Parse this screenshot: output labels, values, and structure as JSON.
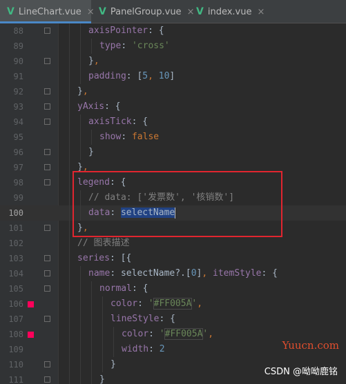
{
  "tabs": [
    {
      "label": "LineChart.vue",
      "icon": "vue-icon",
      "active": true
    },
    {
      "label": "PanelGroup.vue",
      "icon": "vue-icon",
      "active": false
    },
    {
      "label": "index.vue",
      "icon": "vue-icon",
      "active": false
    }
  ],
  "close_glyph": "×",
  "lines": [
    {
      "num": "88",
      "indent": 2,
      "tokens": [
        [
          "k",
          "axisPointer"
        ],
        [
          "plain",
          ": {"
        ]
      ],
      "fold": true
    },
    {
      "num": "89",
      "indent": 3,
      "tokens": [
        [
          "k",
          "type"
        ],
        [
          "plain",
          ": "
        ],
        [
          "s",
          "'cross'"
        ]
      ]
    },
    {
      "num": "90",
      "indent": 2,
      "tokens": [
        [
          "plain",
          "}"
        ],
        [
          "p",
          ","
        ]
      ],
      "fold": true
    },
    {
      "num": "91",
      "indent": 2,
      "tokens": [
        [
          "k",
          "padding"
        ],
        [
          "plain",
          ": ["
        ],
        [
          "n",
          "5"
        ],
        [
          "p",
          ", "
        ],
        [
          "n",
          "10"
        ],
        [
          "plain",
          "]"
        ]
      ]
    },
    {
      "num": "92",
      "indent": 1,
      "tokens": [
        [
          "plain",
          "}"
        ],
        [
          "p",
          ","
        ]
      ],
      "fold": true
    },
    {
      "num": "93",
      "indent": 1,
      "tokens": [
        [
          "k",
          "yAxis"
        ],
        [
          "plain",
          ": {"
        ]
      ],
      "fold": true
    },
    {
      "num": "94",
      "indent": 2,
      "tokens": [
        [
          "k",
          "axisTick"
        ],
        [
          "plain",
          ": {"
        ]
      ],
      "fold": true
    },
    {
      "num": "95",
      "indent": 3,
      "tokens": [
        [
          "k",
          "show"
        ],
        [
          "plain",
          ": "
        ],
        [
          "kw",
          "false"
        ]
      ]
    },
    {
      "num": "96",
      "indent": 2,
      "tokens": [
        [
          "plain",
          "}"
        ]
      ],
      "fold": true
    },
    {
      "num": "97",
      "indent": 1,
      "tokens": [
        [
          "plain",
          "}"
        ],
        [
          "p",
          ","
        ]
      ],
      "fold": true
    },
    {
      "num": "98",
      "indent": 1,
      "tokens": [
        [
          "k",
          "legend"
        ],
        [
          "plain",
          ": {"
        ]
      ],
      "fold": true
    },
    {
      "num": "99",
      "indent": 2,
      "tokens": [
        [
          "c",
          "// data: ['发票数', '核销数']"
        ]
      ]
    },
    {
      "num": "100",
      "indent": 2,
      "tokens": [
        [
          "k",
          "data"
        ],
        [
          "plain",
          ": "
        ],
        [
          "sel",
          "selectName"
        ]
      ],
      "current": true,
      "caret": true
    },
    {
      "num": "101",
      "indent": 1,
      "tokens": [
        [
          "plain",
          "}"
        ],
        [
          "p",
          ","
        ]
      ],
      "fold": true
    },
    {
      "num": "102",
      "indent": 1,
      "tokens": [
        [
          "c",
          "// 图表描述"
        ]
      ]
    },
    {
      "num": "103",
      "indent": 1,
      "tokens": [
        [
          "k",
          "series"
        ],
        [
          "plain",
          ": [{"
        ]
      ],
      "fold": true
    },
    {
      "num": "104",
      "indent": 2,
      "tokens": [
        [
          "k",
          "name"
        ],
        [
          "plain",
          ": selectName?.["
        ],
        [
          "n",
          "0"
        ],
        [
          "plain",
          "]"
        ],
        [
          "p",
          ", "
        ],
        [
          "k",
          "itemStyle"
        ],
        [
          "plain",
          ": {"
        ]
      ],
      "fold": true
    },
    {
      "num": "105",
      "indent": 3,
      "tokens": [
        [
          "k",
          "normal"
        ],
        [
          "plain",
          ": {"
        ]
      ],
      "fold": true
    },
    {
      "num": "106",
      "indent": 4,
      "tokens": [
        [
          "k",
          "color"
        ],
        [
          "plain",
          ": "
        ],
        [
          "s",
          "'"
        ],
        [
          "s",
          "#FF005A"
        ],
        [
          "s",
          "'"
        ],
        [
          "p",
          ","
        ]
      ],
      "bp": true
    },
    {
      "num": "107",
      "indent": 4,
      "tokens": [
        [
          "k",
          "lineStyle"
        ],
        [
          "plain",
          ": {"
        ]
      ],
      "fold": true
    },
    {
      "num": "108",
      "indent": 5,
      "tokens": [
        [
          "k",
          "color"
        ],
        [
          "plain",
          ": "
        ],
        [
          "s",
          "'"
        ],
        [
          "s",
          "#FF005A"
        ],
        [
          "s",
          "'"
        ],
        [
          "p",
          ","
        ]
      ],
      "bp": true
    },
    {
      "num": "109",
      "indent": 5,
      "tokens": [
        [
          "k",
          "width"
        ],
        [
          "plain",
          ": "
        ],
        [
          "n",
          "2"
        ]
      ]
    },
    {
      "num": "110",
      "indent": 4,
      "tokens": [
        [
          "plain",
          "}"
        ]
      ],
      "fold": true
    },
    {
      "num": "111",
      "indent": 3,
      "tokens": [
        [
          "plain",
          "}"
        ]
      ],
      "fold": true
    }
  ],
  "watermark_site": "Yuucn.com",
  "watermark_author": "CSDN @呦呦鹿铭",
  "colors": {
    "breakpoint": "#FF005A",
    "vue": "#41B883",
    "highlight_box": "#E2252F"
  }
}
